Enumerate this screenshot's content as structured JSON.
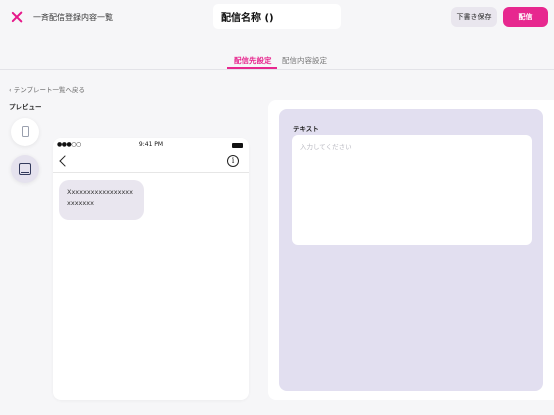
{
  "header": {
    "title": "一斉配信登録内容一覧",
    "delivery_name": "配信名称 ()",
    "draft_button": "下書き保存",
    "send_button": "配信"
  },
  "tabs": [
    {
      "label": "配信先設定",
      "active": true
    },
    {
      "label": "配信内容設定",
      "active": false
    }
  ],
  "back_link": "テンプレート一覧へ戻る",
  "preview": {
    "label": "プレビュー",
    "devices": [
      "phone-icon",
      "tablet-icon"
    ],
    "active_device": "tablet"
  },
  "phone": {
    "signal": "●●●○○",
    "time": "9:41 PM",
    "info_glyph": "i",
    "message": "Xxxxxxxxxxxxxxxxxxxxxxxx"
  },
  "editor": {
    "field_label": "テキスト",
    "placeholder": "入力してください",
    "value": ""
  },
  "colors": {
    "accent": "#e7288f",
    "panel": "#e2dff0",
    "background": "#f6f6f8"
  }
}
